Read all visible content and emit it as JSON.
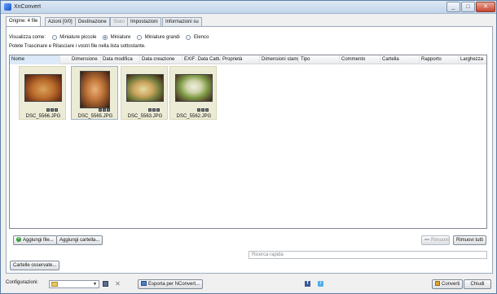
{
  "window": {
    "title": "XnConvert"
  },
  "tabs": [
    {
      "label": "Origine: 4 file",
      "state": "active"
    },
    {
      "label": "Azioni [0/0]",
      "state": "normal"
    },
    {
      "label": "Destinazione",
      "state": "normal"
    },
    {
      "label": "Stato",
      "state": "disabled"
    },
    {
      "label": "Impostazioni",
      "state": "normal"
    },
    {
      "label": "Informazioni su",
      "state": "normal"
    }
  ],
  "view": {
    "label": "Visualizza come:",
    "options": [
      {
        "label": "Miniature piccole",
        "checked": false
      },
      {
        "label": "Miniature",
        "checked": true
      },
      {
        "label": "Miniature grandi",
        "checked": false
      },
      {
        "label": "Elenco",
        "checked": false
      }
    ]
  },
  "hint": "Potete Trascinare e Rilasciare i vostri file nella lista sottostante.",
  "columns": [
    "Nome",
    "Dimensione",
    "Data modifica",
    "Data creazione",
    "EXIF: Data Cattura",
    "Proprietà",
    "Dimensioni stampa",
    "Tipo",
    "Commento",
    "Cartella",
    "Rapporto",
    "Larghezza"
  ],
  "files": [
    {
      "name": "DSC_5566.JPG",
      "orientation": "landscape"
    },
    {
      "name": "DSC_5565.JPG",
      "orientation": "portrait"
    },
    {
      "name": "DSC_5563.JPG",
      "orientation": "landscape"
    },
    {
      "name": "DSC_5562.JPG",
      "orientation": "landscape"
    }
  ],
  "buttons": {
    "add_files": "Aggiungi file...",
    "add_folder": "Aggiungi cartella...",
    "remove": "Rimuovi",
    "remove_all": "Rimuovi tutti",
    "watched_folders": "Cartelle osservate...",
    "export": "Esporta per NConvert...",
    "convert": "Converti",
    "close": "Chiudi"
  },
  "search": {
    "placeholder": "Ricerca rapida"
  },
  "status": {
    "config_label": "Configurazioni:"
  },
  "icons": {
    "app": "xnconvert-app-icon",
    "save": "floppy-save-icon",
    "delete": "close-icon",
    "facebook": "facebook-icon",
    "twitter": "twitter-icon"
  },
  "colors": {
    "accent": "#2b5bb5",
    "thumb_bg": "#ecebd6",
    "header_sorted": "#dbe9f8"
  }
}
